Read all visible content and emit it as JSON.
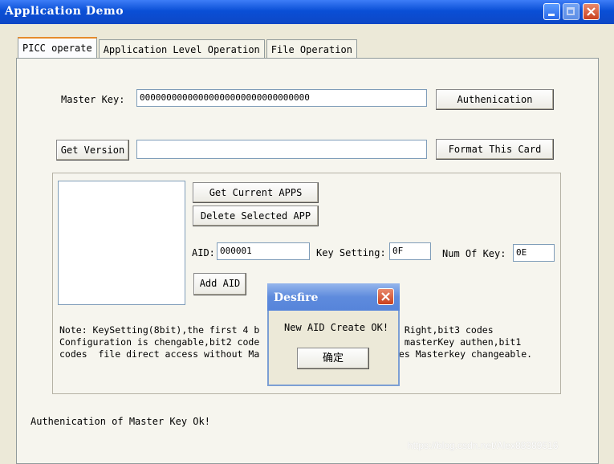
{
  "window": {
    "title": "Application Demo"
  },
  "tabs": [
    {
      "label": "PICC operate",
      "active": true
    },
    {
      "label": "Application Level Operation",
      "active": false
    },
    {
      "label": "File Operation",
      "active": false
    }
  ],
  "master_key": {
    "label": "Master Key:",
    "value": "00000000000000000000000000000000",
    "button": "Authenication"
  },
  "version": {
    "button": "Get Version",
    "value": "",
    "format_button": "Format This Card"
  },
  "apps": {
    "get_button": "Get Current APPS",
    "delete_button": "Delete Selected APP",
    "aid_label": "AID:",
    "aid_value": "000001",
    "key_setting_label": "Key Setting:",
    "key_setting_value": "0F",
    "num_key_label": "Num Of Key:",
    "num_key_value": "0E",
    "add_button": "Add AID"
  },
  "note": {
    "line1": "Note: KeySetting(8bit),the first 4 b",
    "line1b": "s Right,bit3 codes",
    "line2": "Configuration is chengable,bit2 code",
    "line2b": "t masterKey authen,bit1",
    "line3": "codes  file direct access without Ma",
    "line3b": "des Masterkey changeable."
  },
  "status": "Authenication of Master Key Ok!",
  "dialog": {
    "title": "Desfire",
    "message": "New AID Create OK!",
    "ok_button": "确定"
  },
  "watermark": "https://blog.csdn.net/Alex88389516"
}
